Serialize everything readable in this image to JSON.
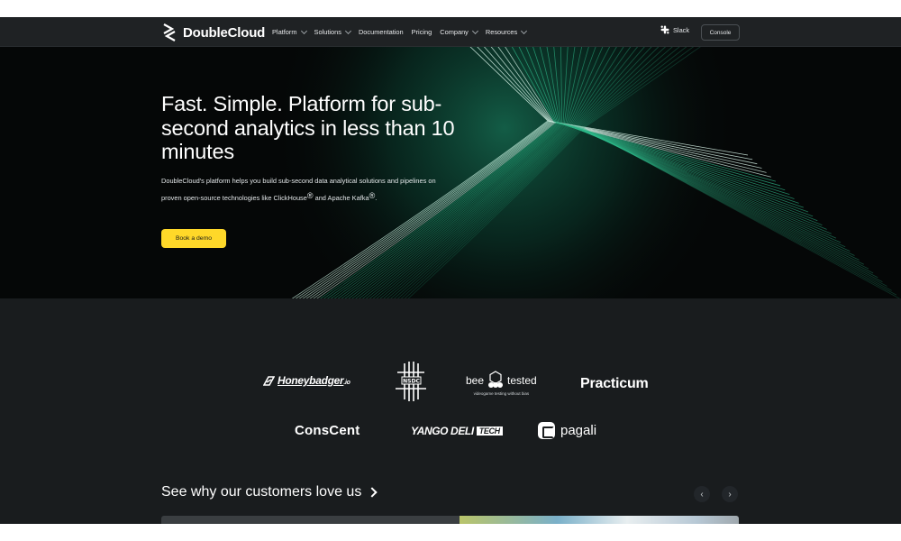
{
  "brand": {
    "name": "DoubleCloud"
  },
  "nav": {
    "items": [
      {
        "label": "Platform",
        "dropdown": true
      },
      {
        "label": "Solutions",
        "dropdown": true
      },
      {
        "label": "Documentation",
        "dropdown": false
      },
      {
        "label": "Pricing",
        "dropdown": false
      },
      {
        "label": "Company",
        "dropdown": true
      },
      {
        "label": "Resources",
        "dropdown": true
      }
    ],
    "slack_label": "Slack",
    "console_label": "Console"
  },
  "hero": {
    "title": "Fast. Simple. Platform for sub-second analytics in less than 10 minutes",
    "description_main": "DoubleCloud's platform helps you build sub-second data analytical solutions and pipelines on proven open-source technologies like ClickHouse",
    "description_and": "and Apache Kafka",
    "registered_mark": "®",
    "cta_label": "Book a demo"
  },
  "customer_logos": {
    "honeybadger": {
      "name": "Honeybadger",
      "suffix": ".io"
    },
    "nsdc": {
      "name": "NSDC"
    },
    "beetested": {
      "left": "bee",
      "right": "tested",
      "tagline": "videogame testing without bias"
    },
    "practicum": {
      "name": "Practicum"
    },
    "conscent": {
      "name": "ConsCent"
    },
    "yango": {
      "name": "YANGO DELI",
      "badge": "TECH"
    },
    "pagali": {
      "name": "pagali"
    }
  },
  "testimonials": {
    "heading": "See why our customers love us",
    "prev_icon": "‹",
    "next_icon": "›"
  },
  "colors": {
    "accent_yellow": "#ffd829",
    "hero_green": "#1fa37a",
    "background": "#191c1e"
  }
}
